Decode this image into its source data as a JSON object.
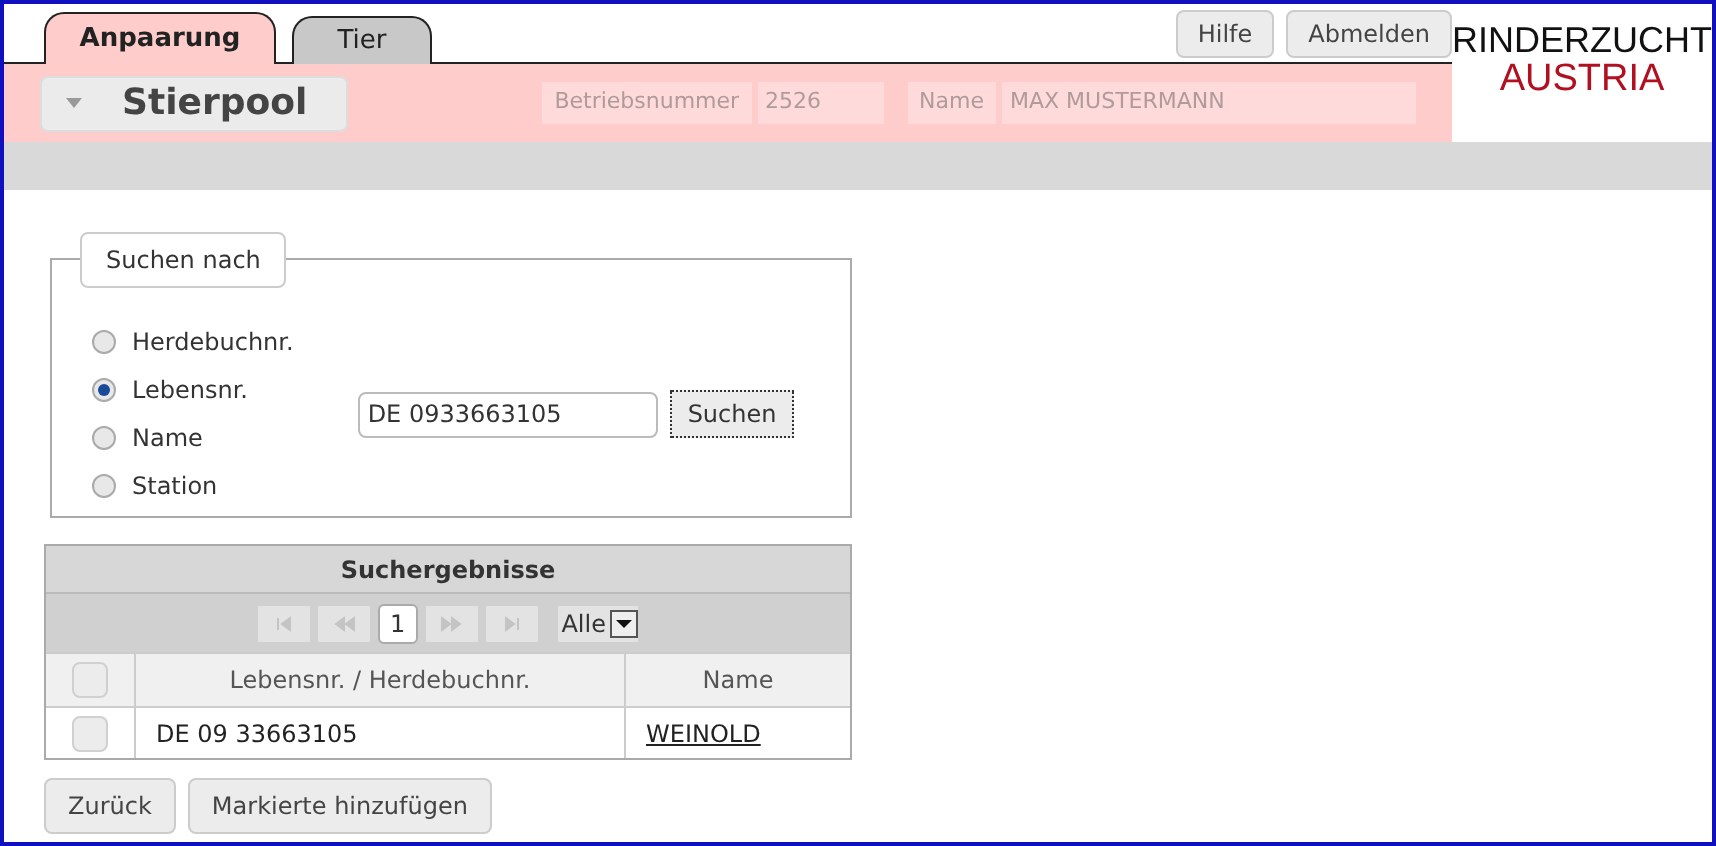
{
  "tabs": [
    {
      "label": "Anpaarung",
      "selected": true
    },
    {
      "label": "Tier",
      "selected": false
    }
  ],
  "header": {
    "menu_title": "Stierpool",
    "fields": [
      {
        "label": "Betriebsnummer",
        "value": "2526"
      },
      {
        "label": "Name",
        "value": "MAX MUSTERMANN"
      }
    ]
  },
  "top_buttons": [
    "Hilfe",
    "Abmelden"
  ],
  "logo": {
    "line_1": "RINDERZUCHT",
    "line_2": "AUSTRIA"
  },
  "search": {
    "legend": "Suchen nach",
    "options": [
      {
        "label": "Herdebuchnr.",
        "selected": false
      },
      {
        "label": "Lebensnr.",
        "selected": true
      },
      {
        "label": "Name",
        "selected": false
      },
      {
        "label": "Station",
        "selected": false
      }
    ],
    "value": "DE 0933663105",
    "button": "Suchen"
  },
  "results": {
    "title": "Suchergebnisse",
    "page": "1",
    "page_size": "Alle",
    "header_checked": false,
    "columns": [
      "Lebensnr. / Herdebuchnr.",
      "Name"
    ],
    "rows": [
      {
        "checked": false,
        "number": "DE 09 33663105",
        "name": "WEINOLD"
      }
    ]
  },
  "buttons": [
    "Zurück",
    "Markierte hinzufügen"
  ]
}
